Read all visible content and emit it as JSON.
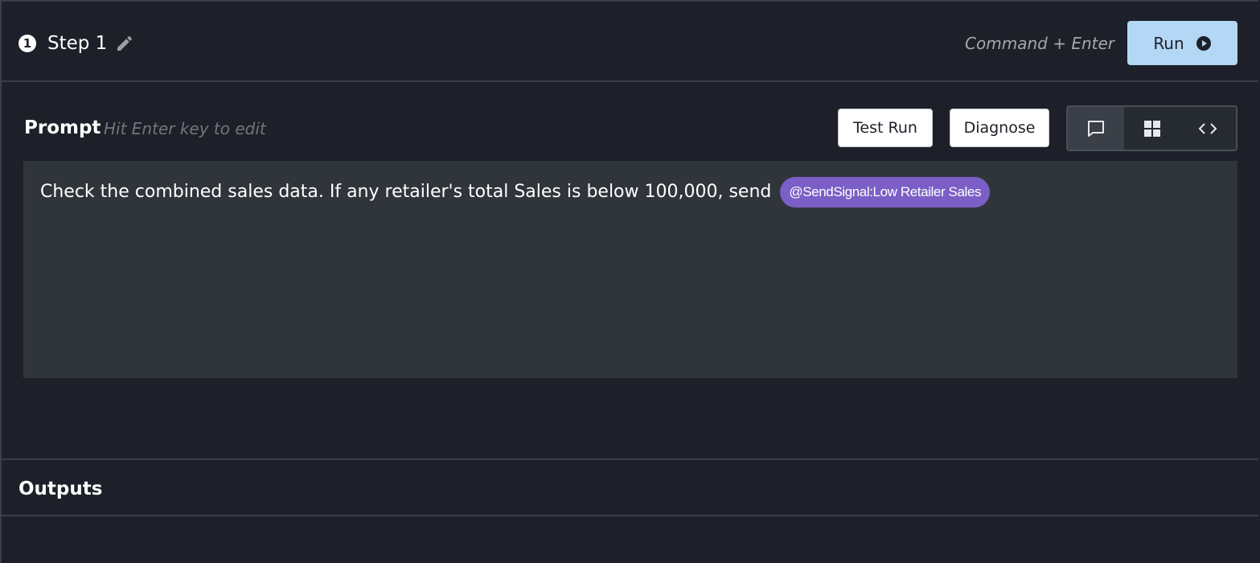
{
  "step": {
    "number": "1",
    "title": "Step 1",
    "edit_icon": "pencil-icon"
  },
  "header": {
    "shortcut": "Command + Enter",
    "run_label": "Run",
    "run_icon": "play-circle-icon",
    "run_color": "#b3d7f5"
  },
  "prompt": {
    "label": "Prompt",
    "hint": "Hit Enter key to edit",
    "test_run_label": "Test Run",
    "diagnose_label": "Diagnose",
    "view_modes": [
      "chat-bubble-icon",
      "grid-icon",
      "code-icon"
    ],
    "active_view": "chat-bubble-icon",
    "text": "Check the combined sales data. If any retailer's total Sales is below 100,000, send",
    "signal_chip": "@SendSignal:Low Retailer Sales",
    "signal_chip_color": "#7b5fc6"
  },
  "outputs": {
    "label": "Outputs"
  }
}
